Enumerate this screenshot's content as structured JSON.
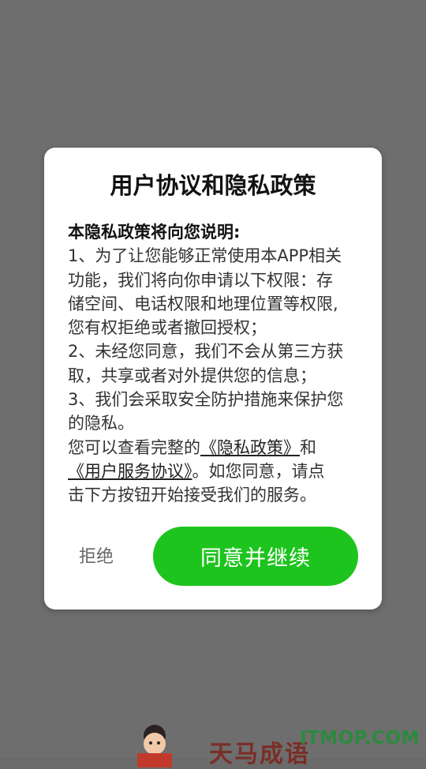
{
  "dialog": {
    "title": "用户协议和隐私政策",
    "heading": "本隐私政策将向您说明:",
    "lines": [
      "1、为了让您能够正常使用本APP相关",
      "功能，我们将向你申请以下权限：存",
      "储空间、电话权限和地理位置等权限,",
      "您有权拒绝或者撤回授权；",
      "2、未经您同意，我们不会从第三方获",
      "取，共享或者对外提供您的信息；",
      "3、我们会采取安全防护措施来保护您",
      "的隐私。"
    ],
    "closing": {
      "prefix": "您可以查看完整的",
      "privacy_link": "《隐私政策》",
      "and": "和",
      "service_link": "《用户服务协议》",
      "suffix_1": "。如您同意，请点",
      "last_line": "击下方按钮开始接受我们的服务。"
    },
    "reject_label": "拒绝",
    "agree_label": "同意并继续"
  },
  "background": {
    "brand_text": "天马成语",
    "watermark": "ITMOP.COM"
  },
  "colors": {
    "overlay": "#6e6e6e",
    "accent_green": "#1ec41e",
    "watermark_green": "#2b8a3e"
  }
}
